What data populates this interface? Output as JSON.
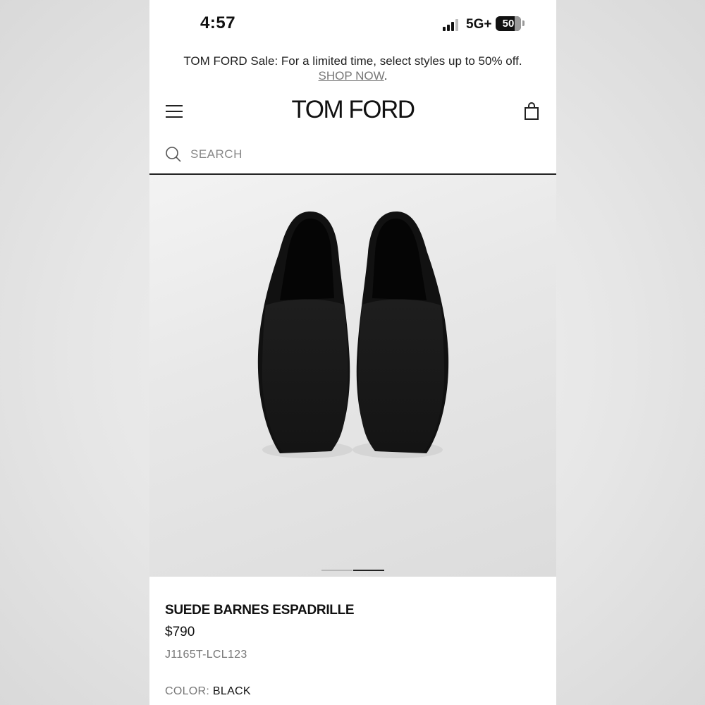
{
  "status_bar": {
    "time": "4:57",
    "network": "5G+",
    "battery": "50"
  },
  "promo": {
    "text": "TOM FORD Sale: For a limited time, select styles up to 50% off.",
    "link": "SHOP NOW",
    "suffix": "."
  },
  "header": {
    "logo": "TOM FORD",
    "menu_icon": "hamburger-menu-icon",
    "bag_icon": "shopping-bag-icon"
  },
  "search": {
    "placeholder": "SEARCH",
    "icon": "search-icon"
  },
  "gallery": {
    "image_count": 2,
    "active_index": 2
  },
  "product": {
    "name": "SUEDE BARNES ESPADRILLE",
    "price": "$790",
    "sku": "J1165T-LCL123",
    "color_label": "COLOR:",
    "color_value": "BLACK"
  }
}
